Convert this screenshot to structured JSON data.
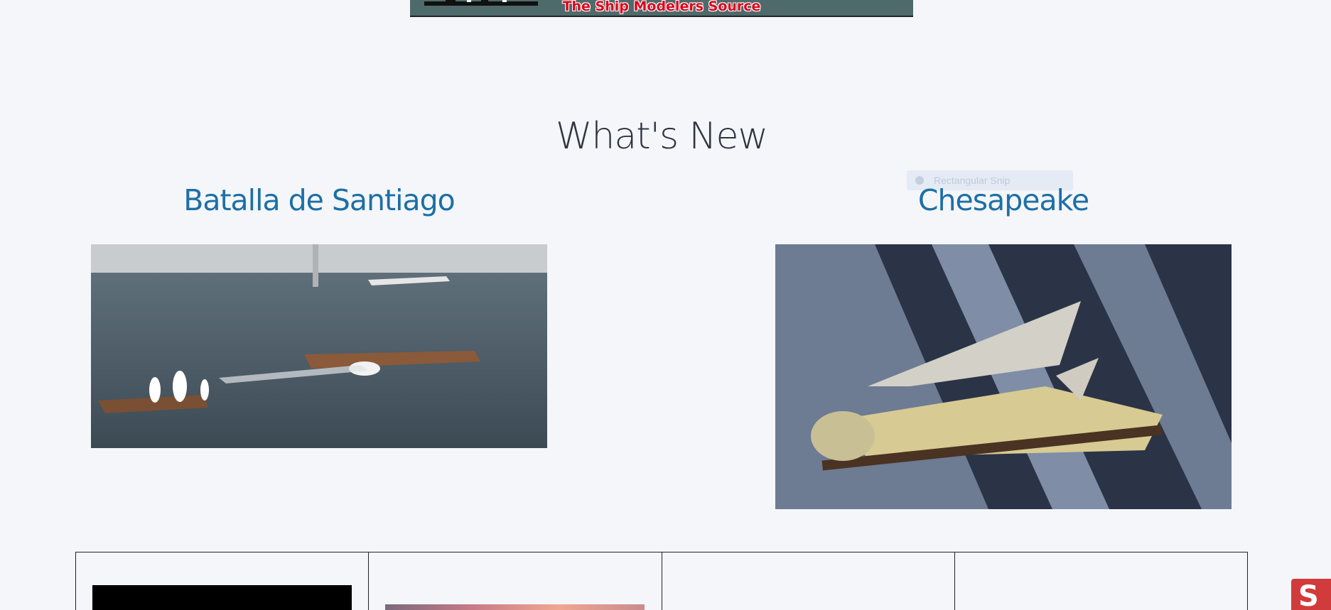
{
  "header": {
    "banner_text": "The Ship Modelers Source",
    "colors": {
      "banner_bg": "#4f6a6a",
      "banner_text": "#e0001a"
    }
  },
  "whats_new": {
    "title": "What's New",
    "ghost_chip": "Rectangular Snip",
    "posts": [
      {
        "title": "Batalla de Santiago",
        "image_icon": "naval-battle-photo"
      },
      {
        "title": "Chesapeake",
        "image_icon": "sailboat-model-photo"
      }
    ]
  },
  "bottom_grid": {
    "cells": [
      {
        "thumb": "black-thumbnail"
      },
      {
        "thumb": "sunset-thumbnail"
      },
      {
        "thumb": ""
      },
      {
        "thumb": ""
      }
    ]
  },
  "side_badge": {
    "glyph": "S",
    "color": "#d23b3b"
  },
  "accent": "#1d6fa5"
}
